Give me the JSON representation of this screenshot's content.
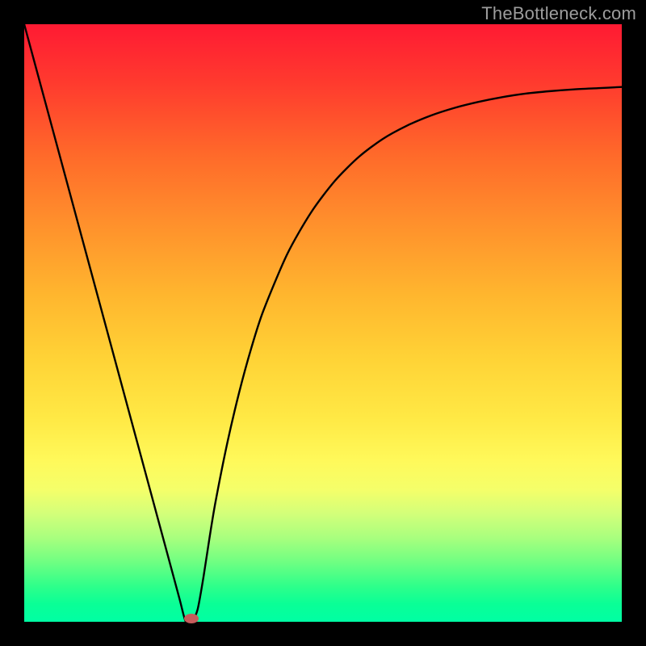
{
  "watermark": "TheBottleneck.com",
  "colors": {
    "frame": "#000000",
    "curve": "#000000",
    "marker": "#c65c5c",
    "gradient_top": "#ff1a33",
    "gradient_bottom": "#00ffa4"
  },
  "chart_data": {
    "type": "line",
    "title": "",
    "xlabel": "",
    "ylabel": "",
    "xlim": [
      0,
      100
    ],
    "ylim": [
      0,
      100
    ],
    "grid": false,
    "legend": "none",
    "x": [
      0,
      2,
      4,
      6,
      8,
      10,
      12,
      14,
      16,
      18,
      20,
      22,
      24,
      26,
      27,
      28,
      29,
      30,
      31,
      32,
      34,
      36,
      38,
      40,
      44,
      48,
      52,
      56,
      60,
      64,
      68,
      72,
      76,
      80,
      84,
      88,
      92,
      96,
      100
    ],
    "values": [
      100,
      92.6,
      85.2,
      77.8,
      70.4,
      63.0,
      55.6,
      48.2,
      40.8,
      33.4,
      26.0,
      18.6,
      11.2,
      3.8,
      0.1,
      0.0,
      2.0,
      7.5,
      14.0,
      20.0,
      30.0,
      38.5,
      45.8,
      52.0,
      61.5,
      68.5,
      73.8,
      77.8,
      80.8,
      83.0,
      84.7,
      86.0,
      87.0,
      87.8,
      88.4,
      88.8,
      89.1,
      89.3,
      89.5
    ],
    "min_point": {
      "x": 28,
      "y": 0
    },
    "annotations": []
  }
}
